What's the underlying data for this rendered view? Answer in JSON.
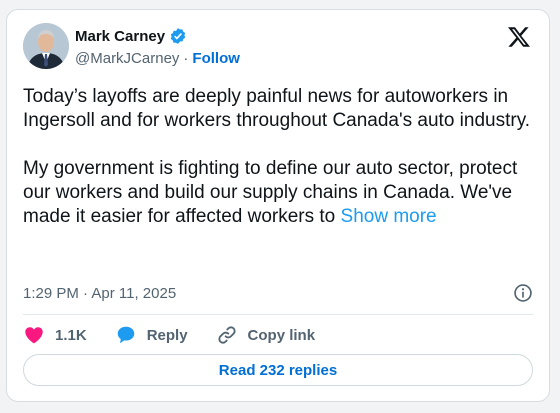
{
  "tweet": {
    "author_name": "Mark Carney",
    "handle": "@MarkJCarney",
    "separator": "·",
    "follow_label": "Follow",
    "text": "Today’s layoffs are deeply painful news for autoworkers in Ingersoll and for workers throughout Canada's auto industry.\n\nMy government is fighting to define our auto sector, protect our workers and build our supply chains in Canada. We've made it easier for affected workers to ",
    "show_more_label": "Show more",
    "time": "1:29 PM",
    "date": "Apr 11, 2025",
    "likes_count": "1.1K",
    "reply_label": "Reply",
    "copy_link_label": "Copy link",
    "read_replies_label": "Read 232 replies"
  },
  "icons": {
    "verified": "verified-badge-icon",
    "x_logo": "x-logo-icon",
    "info": "info-icon",
    "heart": "heart-icon",
    "reply": "speech-bubble-icon",
    "link": "link-icon"
  },
  "colors": {
    "follow": "#006fd6",
    "show_more": "#1d9bf0",
    "verified": "#1d9bf0",
    "heart": "#f91880",
    "reply_bubble": "#1d9bf0"
  }
}
